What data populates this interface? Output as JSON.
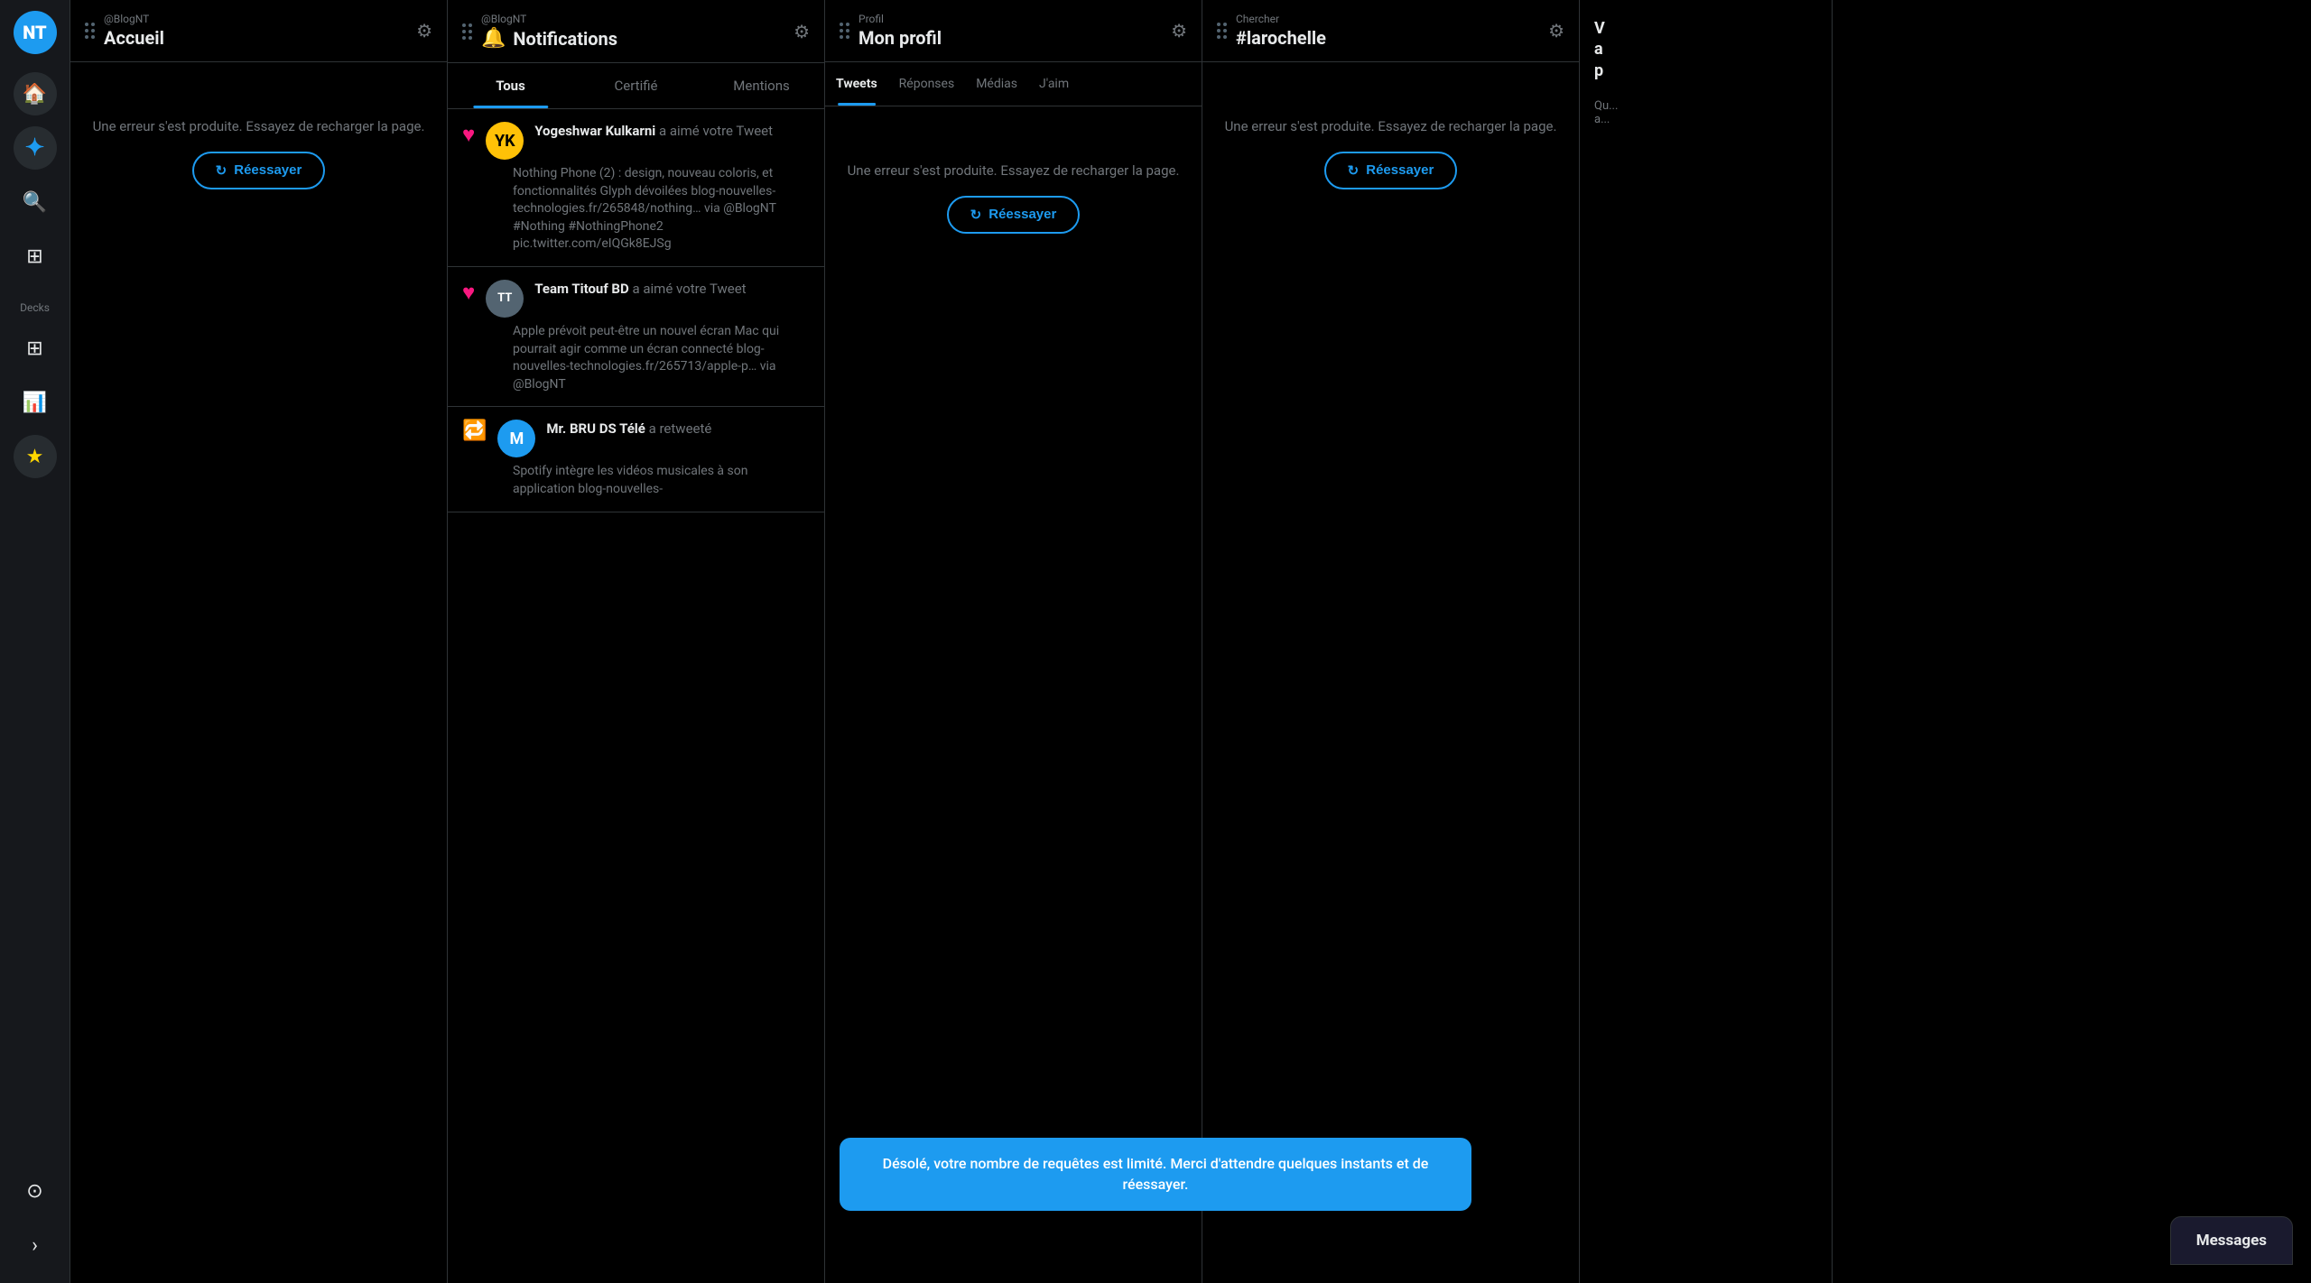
{
  "app": {
    "logo_text": "NT"
  },
  "sidebar": {
    "icons": [
      {
        "name": "home-icon",
        "glyph": "🏠",
        "active": false
      },
      {
        "name": "explore-icon",
        "glyph": "✦",
        "active": true,
        "activeClass": "active"
      },
      {
        "name": "search-icon",
        "glyph": "🔍",
        "active": false
      },
      {
        "name": "compose-icon",
        "glyph": "⊞",
        "active": false
      }
    ],
    "decks_label": "Decks",
    "add_deck_icon": "⊞",
    "chart_icon": "📊",
    "star_icon": "★",
    "messages_icon": "⊙",
    "expand_icon": "›"
  },
  "columns": {
    "home": {
      "account": "@BlogNT",
      "title": "Accueil",
      "error_text": "Une erreur s'est produite. Essayez de recharger la page.",
      "retry_label": "Réessayer"
    },
    "notifications": {
      "account": "@BlogNT",
      "title": "Notifications",
      "bell": "🔔",
      "tabs": [
        {
          "label": "Tous",
          "active": true
        },
        {
          "label": "Certifié",
          "active": false
        },
        {
          "label": "Mentions",
          "active": false
        }
      ],
      "items": [
        {
          "type": "like",
          "icon": "♥",
          "avatar_text": "YK",
          "avatar_class": "avatar-yellow",
          "name": "Yogeshwar Kulkarni",
          "action": "a aimé votre Tweet",
          "content": "Nothing Phone (2) : design, nouveau coloris, et fonctionnalités Glyph dévoilées blog-nouvelles-technologies.fr/265848/nothing… via @BlogNT #Nothing #NothingPhone2 pic.twitter.com/eIQGk8EJSg"
        },
        {
          "type": "like",
          "icon": "♥",
          "avatar_text": "TT",
          "avatar_class": "avatar-gray",
          "name": "Team Titouf BD",
          "action": "a aimé votre Tweet",
          "content": "Apple prévoit peut-être un nouvel écran Mac qui pourrait agir comme un écran connecté blog-nouvelles-technologies.fr/265713/apple-p… via @BlogNT"
        },
        {
          "type": "retweet",
          "icon": "🔁",
          "avatar_text": "M",
          "avatar_class": "avatar-blue",
          "name": "Mr. BRU DS Télé",
          "action": "a retweeté",
          "content": "Spotify intègre les vidéos musicales à son application blog-nouvelles-"
        }
      ]
    },
    "profile": {
      "account": "Profil",
      "title": "Mon profil",
      "tabs": [
        {
          "label": "Tweets",
          "active": true
        },
        {
          "label": "Réponses",
          "active": false
        },
        {
          "label": "Médias",
          "active": false
        },
        {
          "label": "J'aim",
          "active": false
        }
      ],
      "error_text": "Une erreur s'est produite. Essayez de recharger la page.",
      "retry_label": "Réessayer"
    },
    "search": {
      "account": "Chercher",
      "title": "#larochelle",
      "error_text": "Une erreur s'est produite. Essayez de recharger la page.",
      "retry_label": "Réessayer"
    },
    "partial": {
      "line1": "V",
      "line2": "a",
      "line3": "p",
      "sub": "Qu... a..."
    }
  },
  "toast": {
    "text": "Désolé, votre nombre de requêtes est limité. Merci d'attendre quelques instants et de réessayer."
  },
  "messages": {
    "label": "Messages"
  }
}
